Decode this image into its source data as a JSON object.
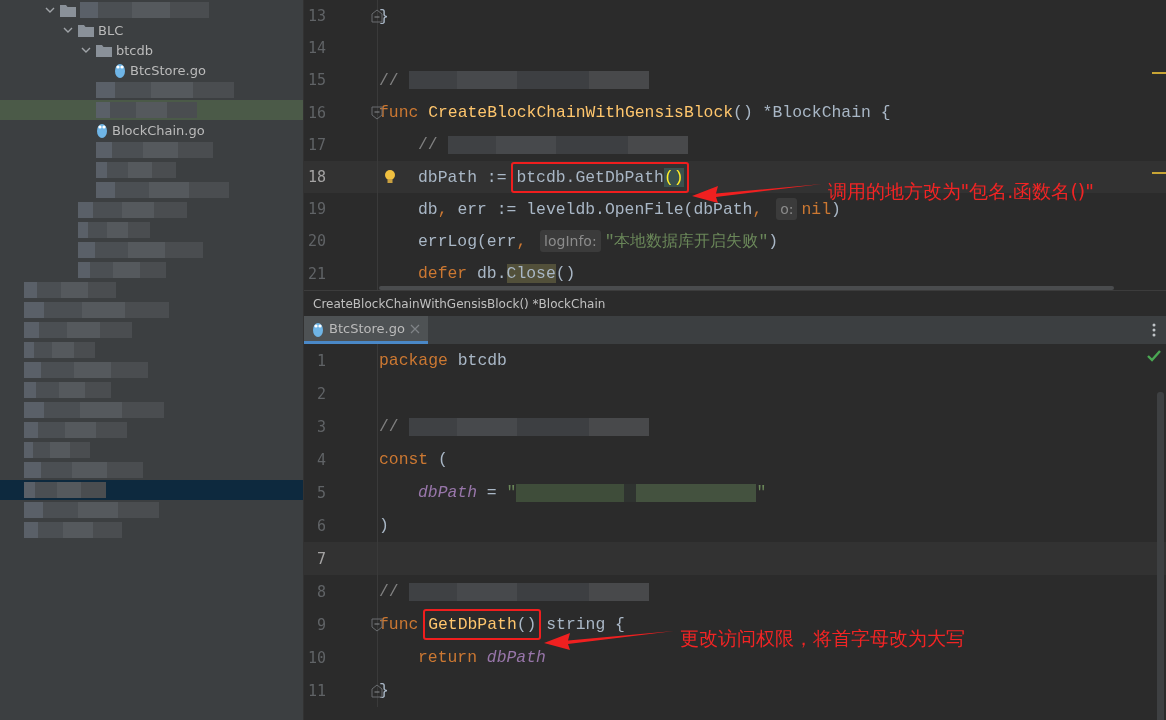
{
  "project_tree": [
    {
      "kind": "folder",
      "redacted": true,
      "expanded": true,
      "selected": false,
      "marked": false,
      "children": [
        {
          "kind": "folder",
          "label": "BLC",
          "redacted": false,
          "expanded": true,
          "selected": false,
          "marked": false,
          "children": [
            {
              "kind": "folder",
              "label": "btcdb",
              "redacted": false,
              "expanded": true,
              "selected": false,
              "marked": false,
              "children": [
                {
                  "kind": "file",
                  "label": "BtcStore.go",
                  "redacted": false,
                  "selected": false,
                  "marked": false
                }
              ]
            },
            {
              "kind": "file",
              "redacted": true,
              "selected": false,
              "marked": false
            },
            {
              "kind": "file",
              "redacted": true,
              "selected": false,
              "marked": true
            },
            {
              "kind": "file",
              "label": "BlockChain.go",
              "redacted": false,
              "selected": false,
              "marked": false
            },
            {
              "kind": "file",
              "redacted": true,
              "selected": false,
              "marked": false
            },
            {
              "kind": "file",
              "redacted": true,
              "selected": false,
              "marked": false
            },
            {
              "kind": "file",
              "redacted": true,
              "selected": false,
              "marked": false
            }
          ]
        },
        {
          "kind": "file",
          "redacted": true,
          "selected": false,
          "marked": false
        },
        {
          "kind": "file",
          "redacted": true,
          "selected": false,
          "marked": false
        },
        {
          "kind": "file",
          "redacted": true,
          "selected": false,
          "marked": false
        },
        {
          "kind": "file",
          "redacted": true,
          "selected": false,
          "marked": false
        }
      ]
    },
    {
      "kind": "file",
      "redacted": true,
      "selected": false,
      "marked": false
    },
    {
      "kind": "file",
      "redacted": true,
      "selected": false,
      "marked": false
    },
    {
      "kind": "file",
      "redacted": true,
      "selected": false,
      "marked": false
    },
    {
      "kind": "file",
      "redacted": true,
      "selected": false,
      "marked": false
    },
    {
      "kind": "file",
      "redacted": true,
      "selected": false,
      "marked": false
    },
    {
      "kind": "file",
      "redacted": true,
      "selected": false,
      "marked": false
    },
    {
      "kind": "file",
      "redacted": true,
      "selected": false,
      "marked": false
    },
    {
      "kind": "file",
      "redacted": true,
      "selected": false,
      "marked": false
    },
    {
      "kind": "file",
      "redacted": true,
      "selected": false,
      "marked": false
    },
    {
      "kind": "file",
      "redacted": true,
      "selected": false,
      "marked": false
    },
    {
      "kind": "file",
      "redacted": true,
      "selected": true,
      "marked": false
    },
    {
      "kind": "file",
      "redacted": true,
      "selected": false,
      "marked": false
    },
    {
      "kind": "file",
      "redacted": true,
      "selected": false,
      "marked": false
    }
  ],
  "top_editor": {
    "lines": [
      {
        "number": "13",
        "kind": "fold-end",
        "current": false,
        "bulb": false,
        "tokens": [
          {
            "kind": "plain",
            "text": "}"
          }
        ]
      },
      {
        "number": "14",
        "kind": "code",
        "current": false,
        "bulb": false
      },
      {
        "number": "15",
        "kind": "code",
        "current": false,
        "bulb": false,
        "tokens": [
          {
            "kind": "comment",
            "text": "// "
          },
          {
            "kind": "redacted"
          }
        ]
      },
      {
        "number": "16",
        "kind": "fold-start",
        "current": false,
        "bulb": false,
        "tokens": [
          {
            "kind": "kw",
            "text": "func "
          },
          {
            "kind": "fn",
            "text": "CreateBlockChainWithGensisBlock"
          },
          {
            "kind": "plain",
            "text": "() *BlockChain {"
          }
        ]
      },
      {
        "number": "17",
        "kind": "code",
        "current": false,
        "bulb": false,
        "tokens": [
          {
            "kind": "indent"
          },
          {
            "kind": "comment",
            "text": "// "
          },
          {
            "kind": "redacted"
          }
        ]
      },
      {
        "number": "18",
        "kind": "code",
        "current": true,
        "bulb": true,
        "tokens": [
          {
            "kind": "indent"
          },
          {
            "kind": "plain",
            "text": "dbPath := "
          },
          {
            "kind": "annotated",
            "callout": "调用的地方改为\"包名.函数名()\"",
            "tokens": [
              {
                "kind": "plain",
                "text": "btcdb.GetDbPath"
              },
              {
                "kind": "match",
                "text": "()"
              }
            ]
          }
        ]
      },
      {
        "number": "19",
        "kind": "code",
        "current": false,
        "bulb": false,
        "tokens": [
          {
            "kind": "indent"
          },
          {
            "kind": "plain",
            "text": "db"
          },
          {
            "kind": "kw",
            "text": ", "
          },
          {
            "kind": "plain",
            "text": "err := leveldb.OpenFile(dbPath"
          },
          {
            "kind": "kw",
            "text": ", "
          },
          {
            "kind": "hint",
            "text": "o:"
          },
          {
            "kind": "kw",
            "text": "nil"
          },
          {
            "kind": "plain",
            "text": ")"
          }
        ]
      },
      {
        "number": "20",
        "kind": "code",
        "current": false,
        "bulb": false,
        "tokens": [
          {
            "kind": "indent"
          },
          {
            "kind": "plain",
            "text": "errLog(err"
          },
          {
            "kind": "kw",
            "text": ", "
          },
          {
            "kind": "hint",
            "text": "logInfo:"
          },
          {
            "kind": "str",
            "text": "\"本地数据库开启失败\""
          },
          {
            "kind": "plain",
            "text": ")"
          }
        ]
      },
      {
        "number": "21",
        "kind": "code",
        "current": false,
        "bulb": false,
        "tokens": [
          {
            "kind": "indent"
          },
          {
            "kind": "kw",
            "text": "defer "
          },
          {
            "kind": "plain",
            "text": "db."
          },
          {
            "kind": "usage",
            "text": "Close"
          },
          {
            "kind": "plain",
            "text": "()"
          }
        ]
      }
    ]
  },
  "breadcrumb": "CreateBlockChainWithGensisBlock() *BlockChain",
  "tabs": [
    {
      "label": "BtcStore.go",
      "selected": true
    }
  ],
  "bottom_editor": {
    "lines": [
      {
        "number": "1",
        "kind": "code",
        "current": false,
        "bulb": false,
        "tokens": [
          {
            "kind": "kw",
            "text": "package "
          },
          {
            "kind": "pkg",
            "text": "btcdb"
          }
        ]
      },
      {
        "number": "2",
        "kind": "code",
        "current": false,
        "bulb": false
      },
      {
        "number": "3",
        "kind": "code",
        "current": false,
        "bulb": false,
        "tokens": [
          {
            "kind": "comment",
            "text": "// "
          },
          {
            "kind": "redacted"
          }
        ]
      },
      {
        "number": "4",
        "kind": "code",
        "current": false,
        "bulb": false,
        "tokens": [
          {
            "kind": "kw",
            "text": "const "
          },
          {
            "kind": "plain",
            "text": "("
          }
        ]
      },
      {
        "number": "5",
        "kind": "code",
        "current": false,
        "bulb": false,
        "tokens": [
          {
            "kind": "indent"
          },
          {
            "kind": "param",
            "text": "dbPath"
          },
          {
            "kind": "plain",
            "text": " = "
          },
          {
            "kind": "str",
            "text": "\""
          },
          {
            "kind": "redacted-str"
          },
          {
            "kind": "str",
            "text": "\""
          }
        ]
      },
      {
        "number": "6",
        "kind": "code",
        "current": false,
        "bulb": false,
        "tokens": [
          {
            "kind": "plain",
            "text": ")"
          }
        ]
      },
      {
        "number": "7",
        "kind": "code",
        "current": true,
        "bulb": false
      },
      {
        "number": "8",
        "kind": "code",
        "current": false,
        "bulb": false,
        "tokens": [
          {
            "kind": "comment",
            "text": "// "
          },
          {
            "kind": "redacted"
          }
        ]
      },
      {
        "number": "9",
        "kind": "fold-start",
        "current": false,
        "bulb": false,
        "tokens": [
          {
            "kind": "kw",
            "text": "func "
          },
          {
            "kind": "annotated",
            "callout": "更改访问权限，将首字母改为大写",
            "tokens": [
              {
                "kind": "fn",
                "text": "GetDbPath"
              },
              {
                "kind": "plain",
                "text": "()"
              }
            ]
          },
          {
            "kind": "plain",
            "text": " string {"
          }
        ]
      },
      {
        "number": "10",
        "kind": "code",
        "current": false,
        "bulb": false,
        "tokens": [
          {
            "kind": "indent"
          },
          {
            "kind": "kw",
            "text": "return "
          },
          {
            "kind": "param",
            "text": "dbPath"
          }
        ]
      },
      {
        "number": "11",
        "kind": "fold-end",
        "current": false,
        "bulb": false,
        "tokens": [
          {
            "kind": "plain",
            "text": "}"
          }
        ]
      }
    ]
  }
}
